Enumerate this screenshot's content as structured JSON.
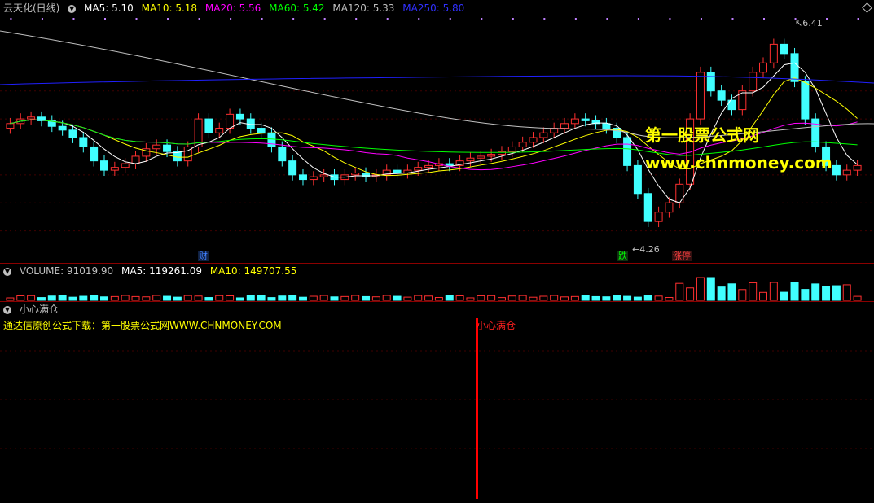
{
  "main": {
    "stock": "云天化(日线)",
    "ma": [
      {
        "label": "MA5: 5.10",
        "color": "#ffffff"
      },
      {
        "label": "MA10: 5.18",
        "color": "#ffff00"
      },
      {
        "label": "MA20: 5.56",
        "color": "#ff00ff"
      },
      {
        "label": "MA60: 5.42",
        "color": "#00ff00"
      },
      {
        "label": "MA120: 5.33",
        "color": "#c0c0c0"
      },
      {
        "label": "MA250: 5.80",
        "color": "#0000ff"
      }
    ],
    "high_label": "6.41",
    "low_label": "4.26",
    "tag_cai": "财",
    "tag_die": "跌",
    "tag_zhang": "涨停",
    "watermark_cn": "第一股票公式网",
    "watermark_url": "www.chnmoney.com"
  },
  "volume": {
    "label": "VOLUME: 91019.90",
    "ma5": "MA5: 119261.09",
    "ma10": "MA10: 149707.55"
  },
  "indicator": {
    "name": "小心满仓",
    "note": "通达信原创公式下载：第一股票公式网WWW.CHNMONEY.COM",
    "signal": "小心满仓"
  },
  "chart_data": {
    "type": "candlestick",
    "ylim": [
      4.0,
      6.6
    ],
    "close": [
      5.45,
      5.5,
      5.52,
      5.48,
      5.42,
      5.38,
      5.3,
      5.2,
      5.05,
      4.95,
      4.98,
      5.02,
      5.1,
      5.18,
      5.22,
      5.15,
      5.05,
      5.2,
      5.5,
      5.35,
      5.4,
      5.55,
      5.5,
      5.4,
      5.35,
      5.2,
      5.05,
      4.9,
      4.85,
      4.88,
      4.9,
      4.85,
      4.9,
      4.92,
      4.88,
      4.9,
      4.95,
      4.92,
      4.95,
      4.98,
      5.0,
      5.02,
      5.0,
      5.05,
      5.08,
      5.1,
      5.12,
      5.15,
      5.2,
      5.25,
      5.3,
      5.35,
      5.4,
      5.45,
      5.5,
      5.48,
      5.45,
      5.4,
      5.3,
      5.0,
      4.7,
      4.4,
      4.5,
      4.6,
      4.8,
      5.5,
      6.0,
      5.8,
      5.7,
      5.6,
      5.8,
      6.0,
      6.1,
      6.3,
      6.2,
      5.9,
      5.5,
      5.2,
      5.0,
      4.9,
      4.95,
      5.0
    ],
    "volume_note": "low volume most days, spike around rebound"
  }
}
